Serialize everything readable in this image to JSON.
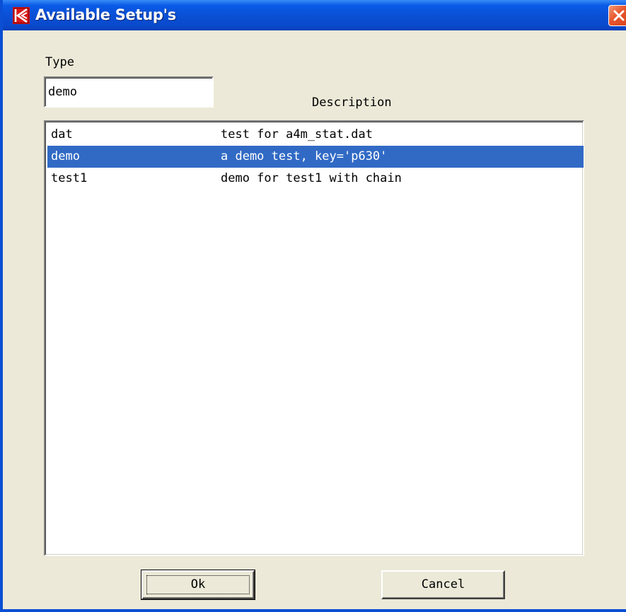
{
  "window": {
    "title": "Available Setup's",
    "app_icon": "k-logo-icon",
    "close_icon": "close-icon"
  },
  "type_field": {
    "label": "Type",
    "value": "demo"
  },
  "description_label": "Description",
  "setups": [
    {
      "type": "dat",
      "description": "test for a4m_stat.dat",
      "selected": false
    },
    {
      "type": "demo",
      "description": "a demo test, key='p630'",
      "selected": true
    },
    {
      "type": "test1",
      "description": "demo for test1 with chain",
      "selected": false
    }
  ],
  "buttons": {
    "ok": "Ok",
    "cancel": "Cancel"
  },
  "colors": {
    "titlebar": "#0a4fd4",
    "selection": "#316ac5",
    "close": "#e8552c",
    "dialog_bg": "#ece9d8"
  }
}
